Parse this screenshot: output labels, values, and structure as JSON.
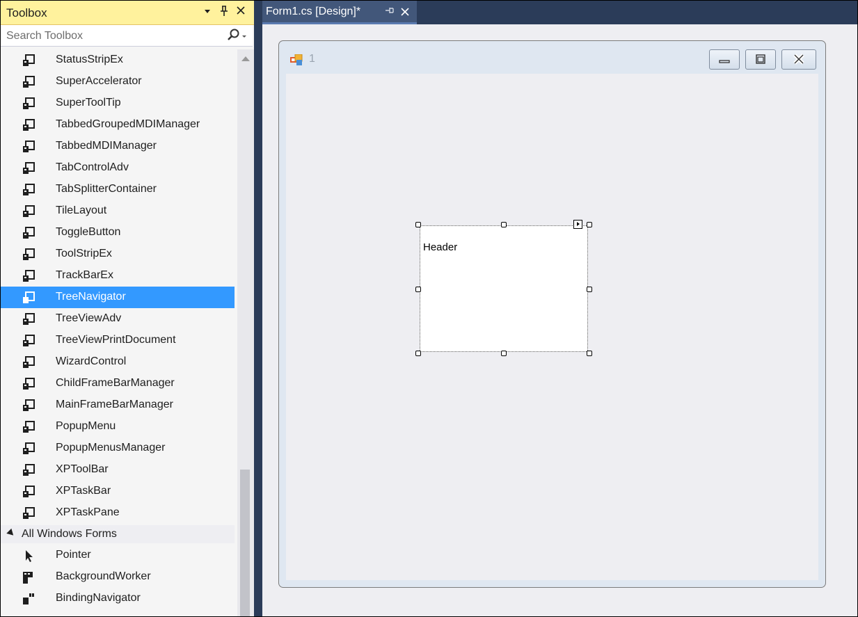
{
  "toolbox": {
    "title": "Toolbox",
    "title_buttons": {
      "dropdown": "▾",
      "pin": "ᵠ",
      "close": "✕"
    },
    "search": {
      "placeholder": "Search Toolbox"
    },
    "items": [
      {
        "label": "StatusStripEx",
        "icon": "component-icon"
      },
      {
        "label": "SuperAccelerator",
        "icon": "component-icon"
      },
      {
        "label": "SuperToolTip",
        "icon": "component-icon"
      },
      {
        "label": "TabbedGroupedMDIManager",
        "icon": "component-icon"
      },
      {
        "label": "TabbedMDIManager",
        "icon": "component-icon"
      },
      {
        "label": "TabControlAdv",
        "icon": "component-icon"
      },
      {
        "label": "TabSplitterContainer",
        "icon": "component-icon"
      },
      {
        "label": "TileLayout",
        "icon": "component-icon"
      },
      {
        "label": "ToggleButton",
        "icon": "component-icon"
      },
      {
        "label": "ToolStripEx",
        "icon": "component-icon"
      },
      {
        "label": "TrackBarEx",
        "icon": "component-icon"
      },
      {
        "label": "TreeNavigator",
        "icon": "component-icon",
        "selected": true
      },
      {
        "label": "TreeViewAdv",
        "icon": "component-icon"
      },
      {
        "label": "TreeViewPrintDocument",
        "icon": "component-icon"
      },
      {
        "label": "WizardControl",
        "icon": "component-icon"
      },
      {
        "label": "ChildFrameBarManager",
        "icon": "component-icon"
      },
      {
        "label": "MainFrameBarManager",
        "icon": "component-icon"
      },
      {
        "label": "PopupMenu",
        "icon": "component-icon"
      },
      {
        "label": "PopupMenusManager",
        "icon": "component-icon"
      },
      {
        "label": "XPToolBar",
        "icon": "component-icon"
      },
      {
        "label": "XPTaskBar",
        "icon": "component-icon"
      },
      {
        "label": "XPTaskPane",
        "icon": "component-icon"
      }
    ],
    "section": {
      "label": "All Windows Forms",
      "expanded": true
    },
    "section_items": [
      {
        "label": "Pointer",
        "icon": "pointer-icon"
      },
      {
        "label": "BackgroundWorker",
        "icon": "background-worker-icon"
      },
      {
        "label": "BindingNavigator",
        "icon": "binding-navigator-icon"
      }
    ],
    "selected_color": "#3399ff"
  },
  "document": {
    "tab_title": "Form1.cs [Design]*",
    "form": {
      "title": "1"
    },
    "control": {
      "label": "Header"
    }
  }
}
